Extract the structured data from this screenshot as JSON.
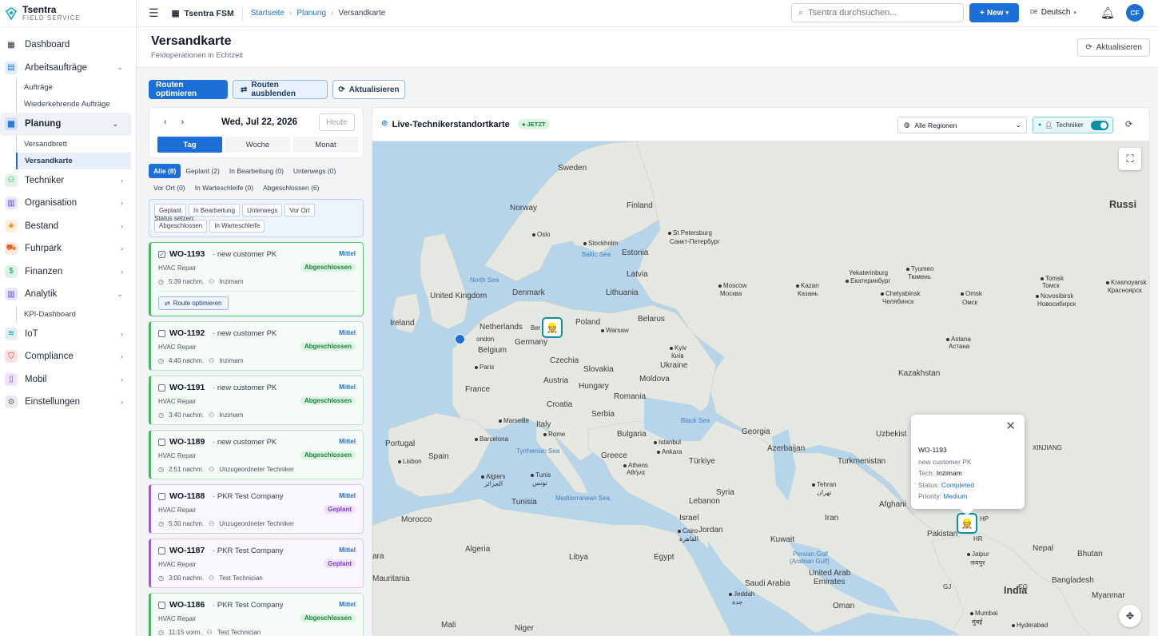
{
  "brand": {
    "name": "Tsentra",
    "tagline": "FIELD SERVICE"
  },
  "sidebar": {
    "items": [
      {
        "label": "Dashboard",
        "icon": "grid-icon"
      },
      {
        "label": "Arbeitsaufträge",
        "icon": "clipboard-icon",
        "color": "#1d6fd8",
        "expanded": true,
        "children": [
          "Aufträge",
          "Wiederkehrende Aufträge"
        ]
      },
      {
        "label": "Planung",
        "icon": "calendar-icon",
        "color": "#1d6fd8",
        "expanded": true,
        "active": true,
        "children": [
          "Versandbrett",
          "Versandkarte"
        ]
      },
      {
        "label": "Techniker",
        "icon": "user-icon",
        "color": "#16a34a"
      },
      {
        "label": "Organisation",
        "icon": "building-icon",
        "color": "#4f46e5"
      },
      {
        "label": "Bestand",
        "icon": "box-icon",
        "color": "#ea8a0c"
      },
      {
        "label": "Fuhrpark",
        "icon": "truck-icon",
        "color": "#ea580c"
      },
      {
        "label": "Finanzen",
        "icon": "dollar-icon",
        "color": "#16a34a"
      },
      {
        "label": "Analytik",
        "icon": "chart-icon",
        "color": "#4f46e5",
        "expanded": true,
        "children": [
          "KPI-Dashboard"
        ]
      },
      {
        "label": "IoT",
        "icon": "wifi-icon",
        "color": "#0891b2"
      },
      {
        "label": "Compliance",
        "icon": "shield-icon",
        "color": "#dc2626"
      },
      {
        "label": "Mobil",
        "icon": "phone-icon",
        "color": "#7c3aed"
      },
      {
        "label": "Einstellungen",
        "icon": "gear-icon",
        "color": "#6b7280"
      }
    ]
  },
  "topbar": {
    "app": "Tsentra FSM",
    "breadcrumb": [
      "Startseite",
      "Planung",
      "Versandkarte"
    ],
    "search_placeholder": "Tsentra durchsuchen...",
    "new_label": "New",
    "lang_code": "DE",
    "lang_label": "Deutsch",
    "avatar": "CF"
  },
  "page": {
    "title": "Versandkarte",
    "subtitle": "Feldoperationen in Echtzeit",
    "refresh": "Aktualisieren"
  },
  "actions": {
    "optimize": "Routen optimieren",
    "hide": "Routen ausblenden",
    "refresh": "Aktualisieren"
  },
  "datebox": {
    "date": "Wed, Jul 22, 2026",
    "today": "Heute",
    "views": [
      "Tag",
      "Woche",
      "Monat"
    ],
    "active_view": "Tag"
  },
  "filters": [
    "Alle (8)",
    "Geplant (2)",
    "In Bearbeitung (0)",
    "Unterwegs (0)",
    "Vor Ort (0)",
    "In Warteschleife (0)",
    "Abgeschlossen (6)"
  ],
  "status_set": {
    "label": "Status setzen:",
    "options": [
      "Geplant",
      "In Bearbeitung",
      "Unterwegs",
      "Vor Ort",
      "Abgeschlossen",
      "In Warteschleife"
    ]
  },
  "orders": [
    {
      "id": "WO-1193",
      "customer": "new customer PK",
      "priority": "Mittel",
      "type": "HVAC Repair",
      "status": "Abgeschlossen",
      "time": "5:39 nachm.",
      "tech": "Inzimam",
      "selected": true,
      "route_btn": "Route optimieren"
    },
    {
      "id": "WO-1192",
      "customer": "new customer PK",
      "priority": "Mittel",
      "type": "HVAC Repair",
      "status": "Abgeschlossen",
      "time": "4:40 nachm.",
      "tech": "Inzimam"
    },
    {
      "id": "WO-1191",
      "customer": "new customer PK",
      "priority": "Mittel",
      "type": "HVAC Repair",
      "status": "Abgeschlossen",
      "time": "3:40 nachm.",
      "tech": "Inzimam"
    },
    {
      "id": "WO-1189",
      "customer": "new customer PK",
      "priority": "Mittel",
      "type": "HVAC Repair",
      "status": "Abgeschlossen",
      "time": "2:51 nachm.",
      "tech": "Unzugeordneter Techniker"
    },
    {
      "id": "WO-1188",
      "customer": "PKR Test Company",
      "priority": "Mittel",
      "type": "HVAC Repair",
      "status": "Geplant",
      "time": "5:30 nachm.",
      "tech": "Unzugeordneter Techniker"
    },
    {
      "id": "WO-1187",
      "customer": "PKR Test Company",
      "priority": "Mittel",
      "type": "HVAC Repair",
      "status": "Geplant",
      "time": "3:00 nachm.",
      "tech": "Test Technician"
    },
    {
      "id": "WO-1186",
      "customer": "PKR Test Company",
      "priority": "Mittel",
      "type": "HVAC Repair",
      "status": "Abgeschlossen",
      "time": "11:15 vorm.",
      "tech": "Test Technician"
    }
  ],
  "map": {
    "title": "Live-Technikerstandortkarte",
    "live_badge": "JETZT",
    "region": "Alle Regionen",
    "tech_toggle": "Techniker",
    "labels": {
      "sweden": "Sweden",
      "finland": "Finland",
      "norway": "Norway",
      "russia": "Russi",
      "oslo": "Oslo",
      "stockholm": "Stockholm",
      "stpete": "St Petersburg",
      "stpete_ru": "Санкт-Петербург",
      "baltic": "Baltic Sea",
      "estonia": "Estonia",
      "latvia": "Latvia",
      "lithuania": "Lithuania",
      "denmark": "Denmark",
      "northsea": "North Sea",
      "uk": "United Kingdom",
      "ireland": "Ireland",
      "netherlands": "Netherlands",
      "ber": "Ber",
      "germany": "Germany",
      "poland": "Poland",
      "warsaw": "Warsaw",
      "belarus": "Belarus",
      "moscow": "Moscow",
      "moscow_ru": "Москва",
      "kazan": "Kazan",
      "kazan_ru": "Казань",
      "yek": "Yekaterinburg",
      "yek_ru": "Екатеринбург",
      "tyumen": "Tyumen",
      "tyumen_ru": "Тюмень",
      "tomsk": "Tomsk",
      "tomsk_ru": "Томск",
      "omsk": "Omsk",
      "omsk_ru": "Омск",
      "chel": "Chelyabinsk",
      "chel_ru": "Челябинск",
      "novo": "Novosibirsk",
      "novo_ru": "Новосибирск",
      "kras": "Krasnoyarsk",
      "kras_ru": "Красноярск",
      "london": "ondon",
      "belgium": "Belgium",
      "paris": "Paris",
      "czechia": "Czechia",
      "kyiv": "Kyiv",
      "kyiv_ru": "Київ",
      "ukraine": "Ukraine",
      "astana": "Astana",
      "astana_ru": "Астана",
      "slovakia": "Slovakia",
      "austria": "Austria",
      "moldova": "Moldova",
      "kazakhstan": "Kazakhstan",
      "france": "France",
      "hungary": "Hungary",
      "romania": "Romania",
      "croatia": "Croatia",
      "serbia": "Serbia",
      "blacksea": "Black Sea",
      "marseille": "Marseille",
      "italy": "Italy",
      "georgia": "Georgia",
      "uzbek": "Uzbekist",
      "barcelona": "Barcelona",
      "rome": "Rome",
      "bulgaria": "Bulgaria",
      "istanbul": "Istanbul",
      "ankara": "Ankara",
      "azerbaijan": "Azerbaijan",
      "portugal": "Portugal",
      "spain": "Spain",
      "lisbon": "Lisbon",
      "tyrrhenian": "Tyrrhenian Sea",
      "greece": "Greece",
      "turkiye": "Türkiye",
      "turkmenistan": "Turkmenistan",
      "xinjiang": "XINJIANG",
      "athens": "Athens",
      "athens_gr": "Αθήνα",
      "algiers": "Algiers",
      "algiers_ar": "الجزائر",
      "tunis": "Tunis",
      "tunis_ar": "تونس",
      "tunisia": "Tunisia",
      "med": "Mediterranean Sea",
      "syria": "Syria",
      "lebanon": "Lebanon",
      "tehran": "Tehran",
      "tehran_fa": "تهران",
      "afghan": "Afghani",
      "morocco": "Morocco",
      "israel": "Israel",
      "jordan": "Jordan",
      "iran": "Iran",
      "cairo": "Cairo",
      "cairo_ar": "القاهرة",
      "pakistan": "Pakistan",
      "hp": "HP",
      "algeria": "Algeria",
      "libya": "Libya",
      "egypt": "Egypt",
      "kuwait": "Kuwait",
      "persian": "Persian Gulf",
      "persian2": "(Arabian Gulf)",
      "hr": "HR",
      "nepal": "Nepal",
      "bhutan": "Bhutan",
      "jaipur": "Jaipur",
      "jaipur_hi": "जयपुर",
      "uae": "United Arab",
      "uae2": "Emirates",
      "saudi": "Saudi Arabia",
      "bangladesh": "Bangladesh",
      "mauritania": "Mauritania",
      "jeddah": "Jeddah",
      "jeddah_ar": "جدة",
      "india": "India",
      "myanmar": "Myanmar",
      "oman": "Oman",
      "mumbai": "Mumbai",
      "mumbai_hi": "मुंबई",
      "mali": "Mali",
      "niger": "Niger",
      "hyderabad": "Hyderabad",
      "aram": "ara",
      "gj": "GJ",
      "cg": "CG"
    },
    "popup": {
      "id": "WO-1193",
      "customer": "new customer PK",
      "tech_label": "Tech:",
      "tech": "Inzimam",
      "status_label": "Status:",
      "status": "Completed",
      "priority_label": "Priority:",
      "priority": "Medium"
    }
  }
}
